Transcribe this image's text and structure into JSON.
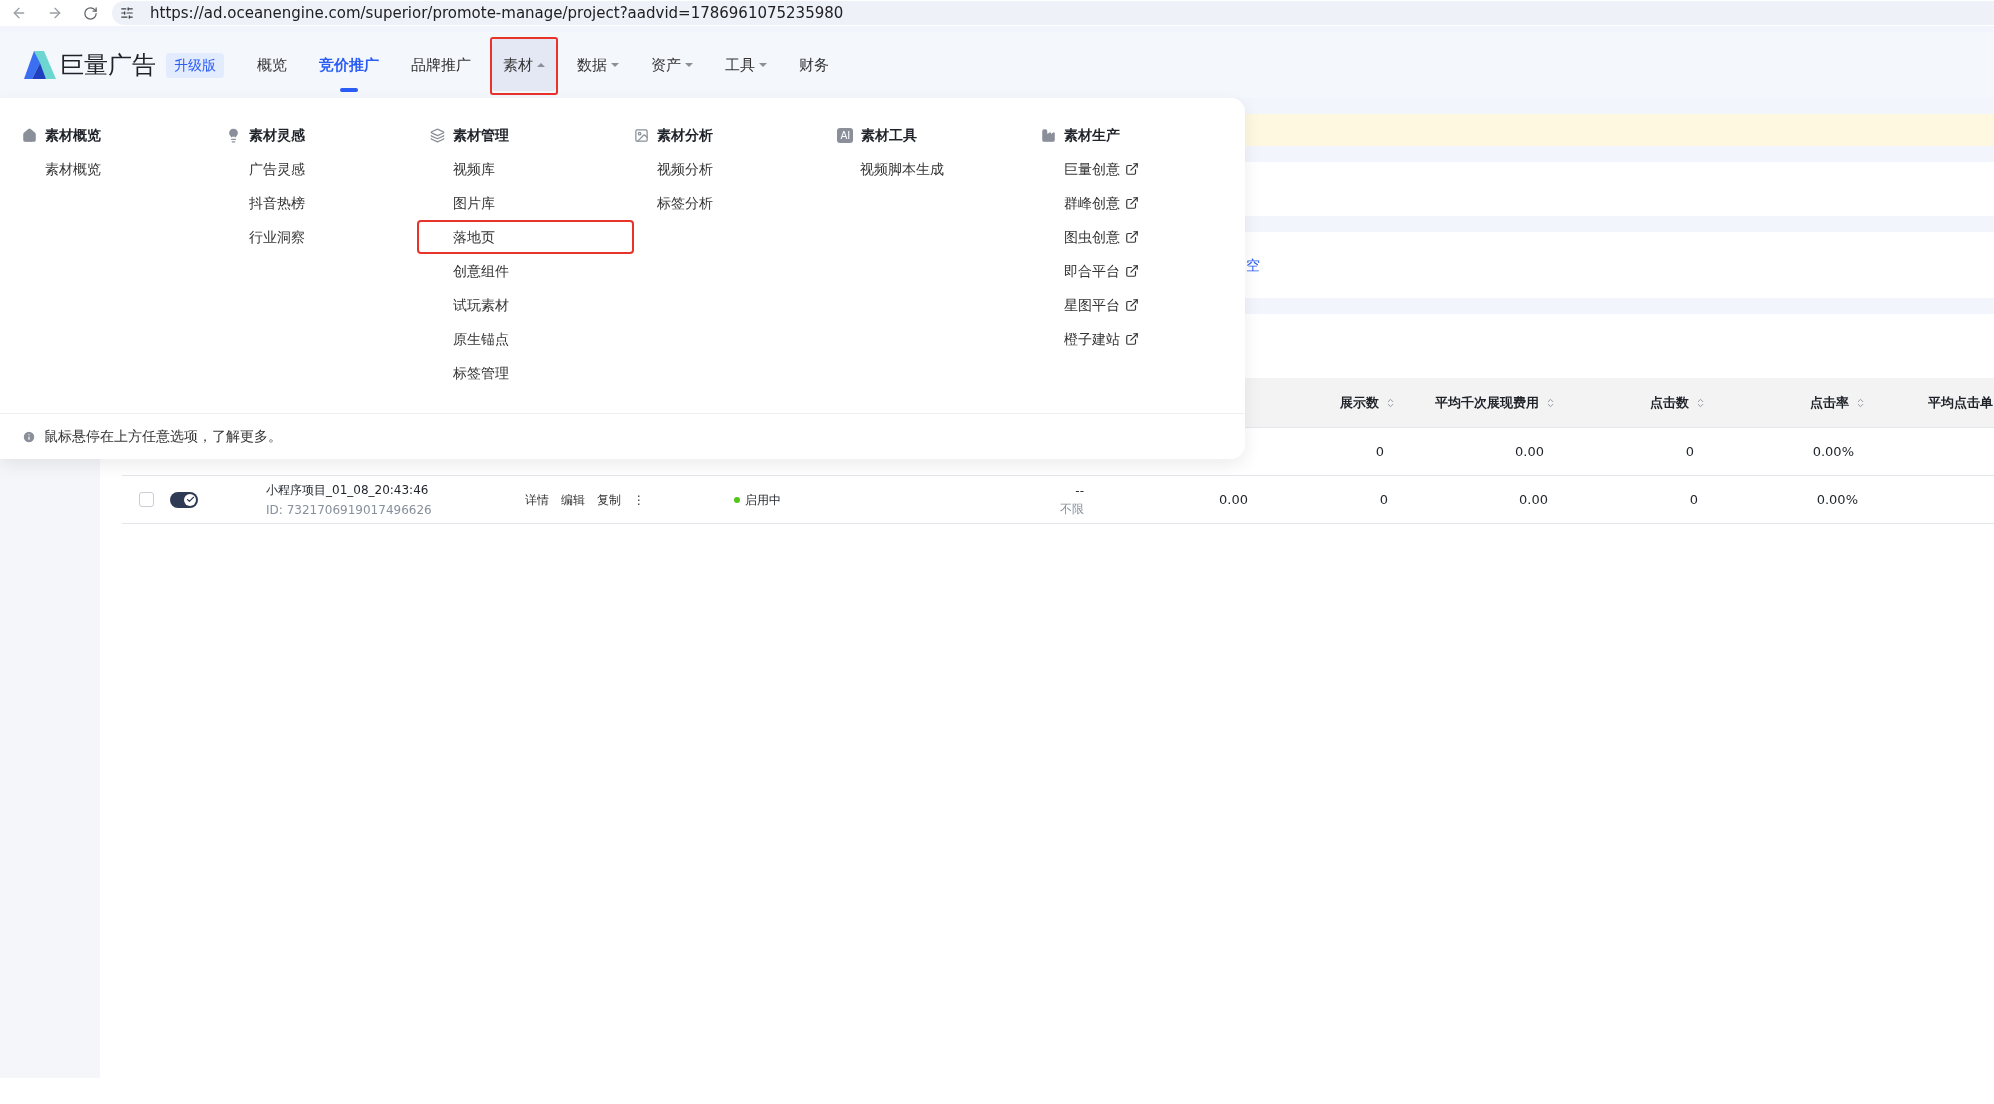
{
  "browser": {
    "url": "https://ad.oceanengine.com/superior/promote-manage/project?aadvid=1786961075235980"
  },
  "header": {
    "logo_text": "巨量广告",
    "badge": "升级版",
    "nav": [
      {
        "label": "概览",
        "kind": "link",
        "selected": false,
        "expanded": false,
        "highlighted": false
      },
      {
        "label": "竞价推广",
        "kind": "link",
        "selected": true,
        "expanded": false,
        "highlighted": false
      },
      {
        "label": "品牌推广",
        "kind": "link",
        "selected": false,
        "expanded": false,
        "highlighted": false
      },
      {
        "label": "素材",
        "kind": "dropdown",
        "selected": false,
        "expanded": true,
        "highlighted": true
      },
      {
        "label": "数据",
        "kind": "dropdown",
        "selected": false,
        "expanded": false,
        "highlighted": false
      },
      {
        "label": "资产",
        "kind": "dropdown",
        "selected": false,
        "expanded": false,
        "highlighted": false
      },
      {
        "label": "工具",
        "kind": "dropdown",
        "selected": false,
        "expanded": false,
        "highlighted": false
      },
      {
        "label": "财务",
        "kind": "link",
        "selected": false,
        "expanded": false,
        "highlighted": false
      }
    ]
  },
  "dropdown": {
    "groups": [
      {
        "title": "素材概览",
        "kind": "home",
        "items": [
          {
            "label": "素材概览",
            "external": false,
            "highlighted": false
          }
        ]
      },
      {
        "title": "素材灵感",
        "kind": "bulb",
        "items": [
          {
            "label": "广告灵感",
            "external": false,
            "highlighted": false
          },
          {
            "label": "抖音热榜",
            "external": false,
            "highlighted": false
          },
          {
            "label": "行业洞察",
            "external": false,
            "highlighted": false
          }
        ]
      },
      {
        "title": "素材管理",
        "kind": "layers",
        "items": [
          {
            "label": "视频库",
            "external": false,
            "highlighted": false
          },
          {
            "label": "图片库",
            "external": false,
            "highlighted": false
          },
          {
            "label": "落地页",
            "external": false,
            "highlighted": true
          },
          {
            "label": "创意组件",
            "external": false,
            "highlighted": false
          },
          {
            "label": "试玩素材",
            "external": false,
            "highlighted": false
          },
          {
            "label": "原生锚点",
            "external": false,
            "highlighted": false
          },
          {
            "label": "标签管理",
            "external": false,
            "highlighted": false
          }
        ]
      },
      {
        "title": "素材分析",
        "kind": "chart",
        "items": [
          {
            "label": "视频分析",
            "external": false,
            "highlighted": false
          },
          {
            "label": "标签分析",
            "external": false,
            "highlighted": false
          }
        ]
      },
      {
        "title": "素材工具",
        "kind": "ai",
        "badge": "AI",
        "items": [
          {
            "label": "视频脚本生成",
            "external": false,
            "highlighted": false
          }
        ]
      },
      {
        "title": "素材生产",
        "kind": "factory",
        "items": [
          {
            "label": "巨量创意",
            "external": true,
            "highlighted": false
          },
          {
            "label": "群峰创意",
            "external": true,
            "highlighted": false
          },
          {
            "label": "图虫创意",
            "external": true,
            "highlighted": false
          },
          {
            "label": "即合平台",
            "external": true,
            "highlighted": false
          },
          {
            "label": "星图平台",
            "external": true,
            "highlighted": false
          },
          {
            "label": "橙子建站",
            "external": true,
            "highlighted": false
          }
        ]
      }
    ],
    "hint": "鼠标悬停在上方任意选项，了解更多。"
  },
  "content": {
    "link_fragment": "空"
  },
  "table": {
    "columns": [
      "展示数",
      "平均千次展现费用",
      "点击数",
      "点击率",
      "平均点击单"
    ],
    "rows": [
      {
        "cells": [
          "0",
          "0.00",
          "0",
          "0.00%"
        ]
      },
      {
        "checked": false,
        "on": true,
        "name": "小程序项目_01_08_20:43:46",
        "id": "ID: 7321706919017496626",
        "actions": [
          "详情",
          "编辑",
          "复制"
        ],
        "more": "⋮",
        "status": "启用中",
        "color": "#52c41a",
        "budget_top": "--",
        "budget": "不限",
        "cost": "0.00",
        "cells": [
          "0",
          "0.00",
          "0",
          "0.00%"
        ]
      }
    ]
  }
}
